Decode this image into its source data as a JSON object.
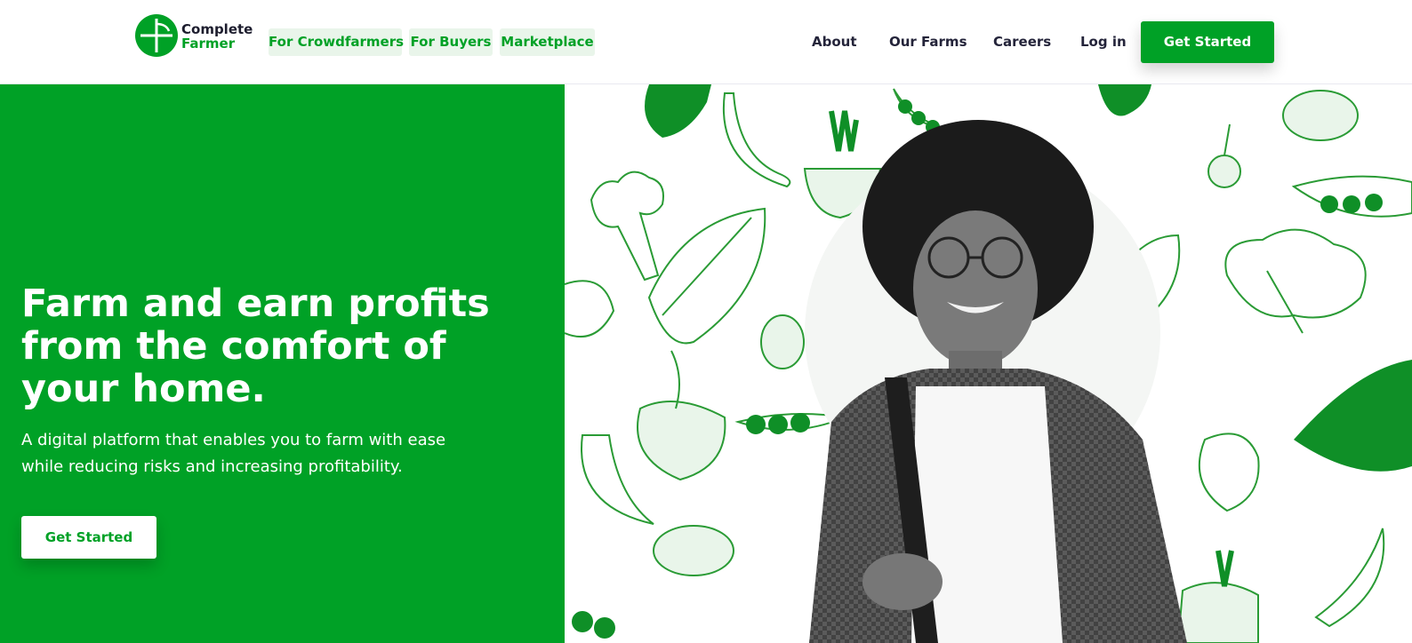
{
  "brand": {
    "name_line1": "Complete",
    "name_line2": "Farmer",
    "primary_color": "#00a126",
    "pill_bg_color": "#e9f5ea"
  },
  "nav": {
    "left_pills": [
      {
        "label": "For Crowdfarmers"
      },
      {
        "label": "For Buyers"
      },
      {
        "label": "Marketplace"
      }
    ],
    "right_links": [
      {
        "label": "About"
      },
      {
        "label": "Our Farms"
      },
      {
        "label": "Careers"
      },
      {
        "label": "Log in"
      }
    ],
    "cta_label": "Get Started"
  },
  "hero": {
    "headline": "Farm and earn profits from the comfort of your home.",
    "subtext": "A digital platform that enables you to farm with ease while reducing risks and increasing profitability.",
    "cta_label": "Get Started",
    "image_icon": "farmer-portrait-with-vegetables-illustration"
  }
}
